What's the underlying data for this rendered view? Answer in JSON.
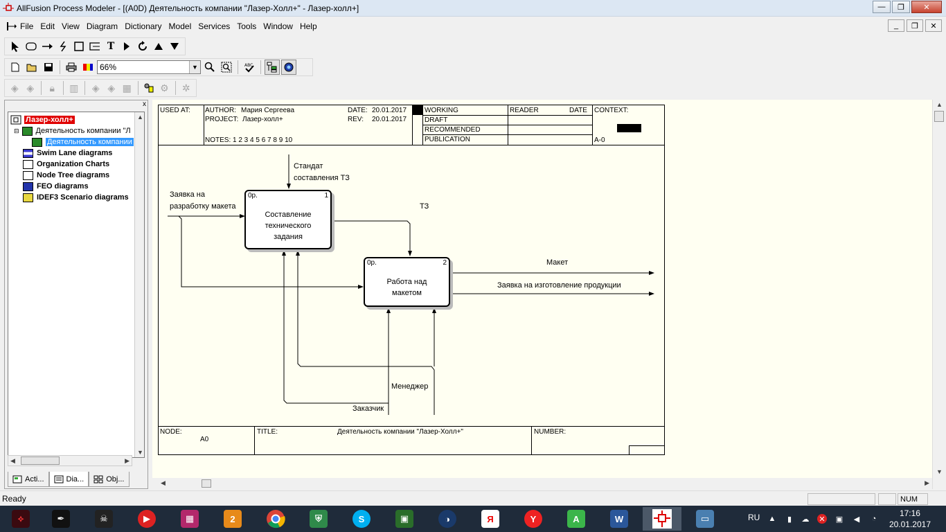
{
  "window": {
    "title": "AllFusion Process Modeler - [(A0D) Деятельность компании  \"Лазер-Холл+\" - Лазер-холл+]",
    "minimize_glyph": "—",
    "maximize_glyph": "❐",
    "close_glyph": "✕"
  },
  "menu": {
    "items": [
      "File",
      "Edit",
      "View",
      "Diagram",
      "Dictionary",
      "Model",
      "Services",
      "Tools",
      "Window",
      "Help"
    ]
  },
  "toolbar": {
    "zoom_value": "66%"
  },
  "explorer": {
    "close_glyph": "x",
    "root": "Лазер-холл+",
    "items": [
      "Деятельность компании \"Л",
      "Деятельность компании",
      "Swim Lane diagrams",
      "Organization Charts",
      "Node Tree diagrams",
      "FEO diagrams",
      "IDEF3 Scenario diagrams"
    ],
    "tabs": [
      "Acti...",
      "Dia...",
      "Obj..."
    ]
  },
  "diagram": {
    "header": {
      "used_at": "USED AT:",
      "author_label": "AUTHOR:",
      "author": "Мария Сергеева",
      "project_label": "PROJECT:",
      "project": "Лазер-холл+",
      "date_label": "DATE:",
      "date": "20.01.2017",
      "rev_label": "REV:",
      "rev": "20.01.2017",
      "notes": "NOTES:  1  2  3  4  5  6  7  8  9  10",
      "working": "WORKING",
      "draft": "DRAFT",
      "recommended": "RECOMMENDED",
      "publication": "PUBLICATION",
      "reader": "READER",
      "reader_date": "DATE",
      "context": "CONTEXT:",
      "context_node": "A-0"
    },
    "footer": {
      "node_label": "NODE:",
      "node": "A0",
      "title_label": "TITLE:",
      "title": "Деятельность компании  \"Лазер-Холл+\"",
      "number_label": "NUMBER:"
    },
    "processes": [
      {
        "cost": "0р.",
        "num": "1",
        "text": [
          "Составление",
          "технического",
          "задания"
        ]
      },
      {
        "cost": "0р.",
        "num": "2",
        "text": [
          "Работа над",
          "макетом"
        ]
      }
    ],
    "arrows": {
      "control_top": [
        "Стандат",
        "составления ТЗ"
      ],
      "input_left": [
        "Заявка на",
        "разработку макета"
      ],
      "tz": "ТЗ",
      "output1": "Макет",
      "output2": "Заявка на изготовление продукции",
      "mech1": "Менеджер",
      "mech2": "Заказчик"
    }
  },
  "status": {
    "text": "Ready",
    "num": "NUM"
  },
  "taskbar": {
    "lang": "RU",
    "time": "17:16",
    "date": "20.01.2017",
    "apps": [
      "rog",
      "feather",
      "pirate",
      "video",
      "photo",
      "plus2",
      "chrome",
      "shield",
      "skype",
      "film",
      "c4d",
      "yandex",
      "yandex-browser",
      "a-app",
      "word",
      "bpwin",
      "picture"
    ]
  }
}
